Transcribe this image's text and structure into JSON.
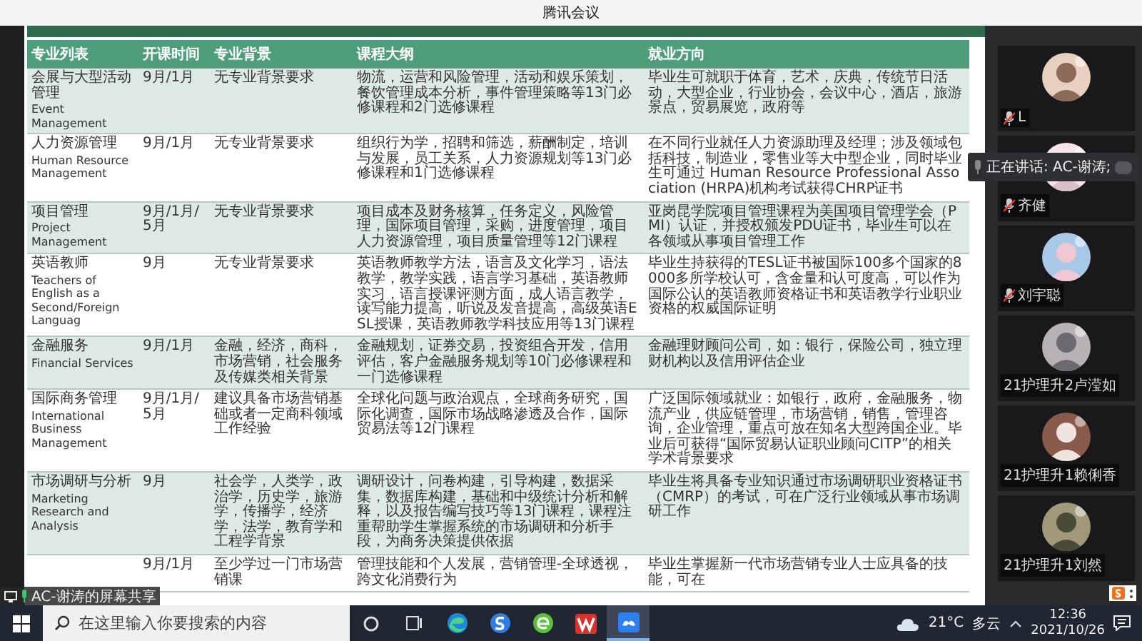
{
  "window": {
    "title": "腾讯会议"
  },
  "table": {
    "columns": [
      "专业列表",
      "开课时间",
      "专业背景",
      "课程大纲",
      "就业方向"
    ],
    "rows": [
      {
        "name_zh": "会展与大型活动管理",
        "name_en": "Event Management",
        "start": "9月/1月",
        "background": "无专业背景要求",
        "outline": "物流，运营和风险管理，活动和娱乐策划，餐饮管理成本分析，事件管理策略等13门必修课程和2门选修课程",
        "career": "毕业生可就职于体育，艺术，庆典，传统节日活动，大型企业，行业协会，会议中心，酒店，旅游景点，贸易展览，政府等"
      },
      {
        "name_zh": "人力资源管理",
        "name_en": "Human Resource Management",
        "start": "9月/1月",
        "background": "无专业背景要求",
        "outline": "组织行为学，招聘和筛选，薪酬制定，培训与发展，员工关系，人力资源规划等13门必修课程和1门选修课程",
        "career": "在不同行业就任人力资源助理及经理；涉及领域包括科技，制造业，零售业等大中型企业，同时毕业生可通过 Human Resource Professional Association (HRPA)机构考试获得CHRP证书"
      },
      {
        "name_zh": "项目管理",
        "name_en": "Project Management",
        "start": "9月/1月/5月",
        "background": "无专业背景要求",
        "outline": "项目成本及财务核算，任务定义，风险管理，国际项目管理，采购，进度管理，项目人力资源管理，项目质量管理等12门课程",
        "career": "亚岗昆学院项目管理课程为美国项目管理学会（PMI）认证，并授权颁发PDU证书，毕业生可以在各领域从事项目管理工作"
      },
      {
        "name_zh": "英语教师",
        "name_en": "Teachers of English as a Second/Foreign Languag",
        "start": "9月",
        "background": "无专业背景要求",
        "outline": "英语教师教学方法，语言及文化学习，语法教学，教学实践，语言学习基础，英语教师实习，语言授课评测方面，成人语言教学，读写能力提高，听说及发音提高，高级英语ESL授课，英语教师教学科技应用等13门课程",
        "career": "毕业生持获得的TESL证书被国际100多个国家的8000多所学校认可，含金量和认可度高，可以作为国际公认的英语教师资格证书和英语教学行业职业资格的权威国际证明"
      },
      {
        "name_zh": "金融服务",
        "name_en": "Financial Services",
        "start": "9月/1月",
        "background": "金融，经济，商科，市场营销，社会服务及传媒类相关背景",
        "outline": "金融规划，证券交易，投资组合开发，信用评估，客户金融服务规划等10门必修课程和一门选修课程",
        "career": "金融理财顾问公司，如：银行，保险公司，独立理财机构以及信用评估企业"
      },
      {
        "name_zh": "国际商务管理",
        "name_en": "International Business Management",
        "start": "9月/1月/5月",
        "background": "建议具备市场营销基础或者一定商科领域工作经验",
        "outline": "全球化问题与政治观点，全球商务研究，国际化调查，国际市场战略渗透及合作，国际贸易法等12门课程",
        "career": "广泛国际领域就业：如银行，政府，金融服务，物流产业，供应链管理，市场营销，销售，管理咨询，企业管理，重点可放在知名大型跨国企业。毕业后可获得“国际贸易认证职业顾问CITP”的相关学术背景要求"
      },
      {
        "name_zh": "市场调研与分析",
        "name_en": "Marketing Research and Analysis",
        "start": "9月",
        "background": "社会学，人类学，政治学，历史学，旅游学，传播学，经济学，法学，教育学和工程学背景",
        "outline": "调研设计，问卷构建，引导构建，数据采集，数据库构建，基础和中级统计分析和解释，以及报告编写技巧等13门课程，课程注重帮助学生掌握系统的市场调研和分析手段，为商务决策提供依据",
        "career": "毕业生将具备专业知识通过市场调研职业资格证书（CMRP）的考试，可在广泛行业领域从事市场调研工作"
      },
      {
        "start": "9月/1月",
        "background": "至少学过一门市场营销课",
        "outline": "管理技能和个人发展，营销管理-全球透视，跨文化消费行为",
        "career": "毕业生掌握新一代市场营销专业人士应具备的技能，可在"
      }
    ]
  },
  "speaking": {
    "text": "正在讲话: AC-谢涛;"
  },
  "share_banner": {
    "text": "AC-谢涛的屏幕共享"
  },
  "participants": [
    {
      "name": "L",
      "mic_muted": true
    },
    {
      "name": "齐健",
      "mic_muted": true
    },
    {
      "name": "刘宇聪",
      "mic_muted": true
    },
    {
      "name": "21护理升2卢滢如",
      "mic_muted": false
    },
    {
      "name": "21护理升1赖俐香",
      "mic_muted": false
    },
    {
      "name": "21护理升1刘然",
      "mic_muted": false
    }
  ],
  "taskbar": {
    "search": {
      "placeholder": "在这里输入你要搜索的内容"
    },
    "apps": [
      {
        "kind": "cortana",
        "selected": false
      },
      {
        "kind": "taskview",
        "selected": false
      },
      {
        "kind": "edge",
        "selected": false
      },
      {
        "kind": "sogou",
        "selected": false
      },
      {
        "kind": "ebrowser",
        "selected": false
      },
      {
        "kind": "wps",
        "selected": false
      },
      {
        "kind": "meeting",
        "selected": true
      }
    ],
    "weather": {
      "temperature": "21°C",
      "condition": "多云"
    },
    "time": "12:36",
    "date": "2021/10/26"
  }
}
